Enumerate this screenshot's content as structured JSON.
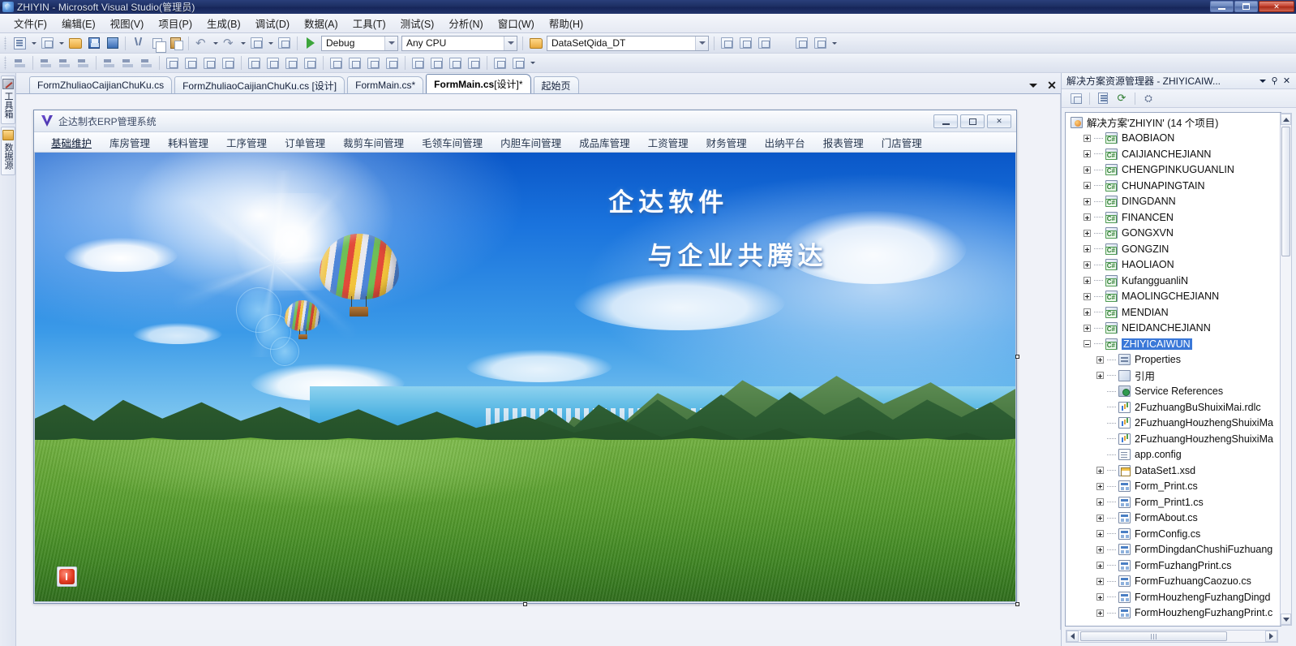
{
  "window": {
    "title": "ZHIYIN - Microsoft Visual Studio(管理员)",
    "minimize_label": "最小化",
    "maximize_label": "最大化",
    "close_label": "关闭"
  },
  "menubar": {
    "items": [
      {
        "label": "文件(F)",
        "name": "menu-file"
      },
      {
        "label": "编辑(E)",
        "name": "menu-edit"
      },
      {
        "label": "视图(V)",
        "name": "menu-view"
      },
      {
        "label": "项目(P)",
        "name": "menu-project"
      },
      {
        "label": "生成(B)",
        "name": "menu-build"
      },
      {
        "label": "调试(D)",
        "name": "menu-debug"
      },
      {
        "label": "数据(A)",
        "name": "menu-data"
      },
      {
        "label": "工具(T)",
        "name": "menu-tools"
      },
      {
        "label": "测试(S)",
        "name": "menu-test"
      },
      {
        "label": "分析(N)",
        "name": "menu-analyze"
      },
      {
        "label": "窗口(W)",
        "name": "menu-window"
      },
      {
        "label": "帮助(H)",
        "name": "menu-help"
      }
    ]
  },
  "toolbar": {
    "config_value": "Debug",
    "platform_value": "Any CPU",
    "dataset_value": "DataSetQida_DT",
    "start_label": "启动调试"
  },
  "left_dock": {
    "tabs": [
      {
        "label": "工具箱",
        "icon": "toolbox-icon"
      },
      {
        "label": "数据源",
        "icon": "data-sources-icon"
      }
    ]
  },
  "tabstrip": {
    "tabs": [
      {
        "label": "FormZhuliaoCaijianChuKu.cs",
        "active": false
      },
      {
        "label": "FormZhuliaoCaijianChuKu.cs [设计]",
        "active": false
      },
      {
        "label": "FormMain.cs*",
        "active": false
      },
      {
        "label": "FormMain.cs",
        "suffix": " [设计]*",
        "active": true
      },
      {
        "label": "起始页",
        "active": false
      }
    ]
  },
  "winform": {
    "title": "企达制衣ERP管理系统",
    "menu": [
      "基础维护",
      "库房管理",
      "耗料管理",
      "工序管理",
      "订单管理",
      "裁剪车间管理",
      "毛领车间管理",
      "内胆车间管理",
      "成品库管理",
      "工资管理",
      "财务管理",
      "出纳平台",
      "报表管理",
      "门店管理"
    ],
    "selected_menu": "基础维护",
    "hero_line1": "企达软件",
    "hero_line2": "与企业共腾达",
    "exit_button_label": "退出"
  },
  "solution_explorer": {
    "title": "解决方案资源管理器 - ZHIYICAIW...",
    "toolbar_icons": [
      "properties-icon",
      "show-all-files-icon",
      "refresh-icon",
      "view-class-diagram-icon"
    ],
    "root": "解决方案'ZHIYIN' (14 个项目)",
    "tree": [
      {
        "label": "BAOBIAON",
        "icon": "csharp-project-icon",
        "expander": "plus",
        "depth": 1,
        "selected": false
      },
      {
        "label": "CAIJIANCHEJIANN",
        "icon": "csharp-project-icon",
        "expander": "plus",
        "depth": 1,
        "selected": false
      },
      {
        "label": "CHENGPINKUGUANLIN",
        "icon": "csharp-project-icon",
        "expander": "plus",
        "depth": 1,
        "selected": false
      },
      {
        "label": "CHUNAPINGTAIN",
        "icon": "csharp-project-icon",
        "expander": "plus",
        "depth": 1,
        "selected": false
      },
      {
        "label": "DINGDANN",
        "icon": "csharp-project-icon",
        "expander": "plus",
        "depth": 1,
        "selected": false
      },
      {
        "label": "FINANCEN",
        "icon": "csharp-project-icon",
        "expander": "plus",
        "depth": 1,
        "selected": false
      },
      {
        "label": "GONGXVN",
        "icon": "csharp-project-icon",
        "expander": "plus",
        "depth": 1,
        "selected": false
      },
      {
        "label": "GONGZIN",
        "icon": "csharp-project-icon",
        "expander": "plus",
        "depth": 1,
        "selected": false
      },
      {
        "label": "HAOLIAON",
        "icon": "csharp-project-icon",
        "expander": "plus",
        "depth": 1,
        "selected": false
      },
      {
        "label": "KufangguanliN",
        "icon": "csharp-project-icon",
        "expander": "plus",
        "depth": 1,
        "selected": false
      },
      {
        "label": "MAOLINGCHEJIANN",
        "icon": "csharp-project-icon",
        "expander": "plus",
        "depth": 1,
        "selected": false
      },
      {
        "label": "MENDIAN",
        "icon": "csharp-project-icon",
        "expander": "plus",
        "depth": 1,
        "selected": false
      },
      {
        "label": "NEIDANCHEJIANN",
        "icon": "csharp-project-icon",
        "expander": "plus",
        "depth": 1,
        "selected": false
      },
      {
        "label": "ZHIYICAIWUN",
        "icon": "csharp-project-icon",
        "expander": "minus",
        "depth": 1,
        "selected": true
      },
      {
        "label": "Properties",
        "icon": "properties-folder-icon",
        "expander": "plus",
        "depth": 2,
        "selected": false
      },
      {
        "label": "引用",
        "icon": "references-icon",
        "expander": "plus",
        "depth": 2,
        "selected": false
      },
      {
        "label": "Service References",
        "icon": "service-references-icon",
        "expander": "none",
        "depth": 2,
        "selected": false
      },
      {
        "label": "2FuzhuangBuShuixiMai.rdlc",
        "icon": "report-icon",
        "expander": "none",
        "depth": 2,
        "selected": false
      },
      {
        "label": "2FuzhuangHouzhengShuixiMa",
        "icon": "report-icon",
        "expander": "none",
        "depth": 2,
        "selected": false
      },
      {
        "label": "2FuzhuangHouzhengShuixiMa",
        "icon": "report-icon",
        "expander": "none",
        "depth": 2,
        "selected": false
      },
      {
        "label": "app.config",
        "icon": "config-file-icon",
        "expander": "none",
        "depth": 2,
        "selected": false
      },
      {
        "label": "DataSet1.xsd",
        "icon": "dataset-icon",
        "expander": "plus",
        "depth": 2,
        "selected": false
      },
      {
        "label": "Form_Print.cs",
        "icon": "windows-form-icon",
        "expander": "plus",
        "depth": 2,
        "selected": false
      },
      {
        "label": "Form_Print1.cs",
        "icon": "windows-form-icon",
        "expander": "plus",
        "depth": 2,
        "selected": false
      },
      {
        "label": "FormAbout.cs",
        "icon": "windows-form-icon",
        "expander": "plus",
        "depth": 2,
        "selected": false
      },
      {
        "label": "FormConfig.cs",
        "icon": "windows-form-icon",
        "expander": "plus",
        "depth": 2,
        "selected": false
      },
      {
        "label": "FormDingdanChushiFuzhuang",
        "icon": "windows-form-icon",
        "expander": "plus",
        "depth": 2,
        "selected": false
      },
      {
        "label": "FormFuzhangPrint.cs",
        "icon": "windows-form-icon",
        "expander": "plus",
        "depth": 2,
        "selected": false
      },
      {
        "label": "FormFuzhuangCaozuo.cs",
        "icon": "windows-form-icon",
        "expander": "plus",
        "depth": 2,
        "selected": false
      },
      {
        "label": "FormHouzhengFuzhangDingd",
        "icon": "windows-form-icon",
        "expander": "plus",
        "depth": 2,
        "selected": false
      },
      {
        "label": "FormHouzhengFuzhangPrint.c",
        "icon": "windows-form-icon",
        "expander": "plus",
        "depth": 2,
        "selected": false
      }
    ]
  }
}
